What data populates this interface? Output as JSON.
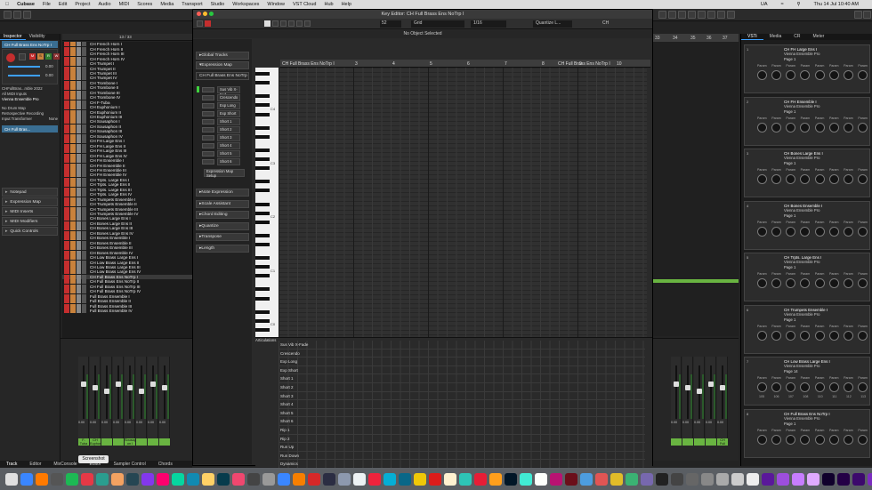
{
  "menubar": {
    "app": "Cubase",
    "items": [
      "File",
      "Edit",
      "Project",
      "Audio",
      "MIDI",
      "Scores",
      "Media",
      "Transport",
      "Studio",
      "Workspaces",
      "Window",
      "VST Cloud",
      "Hub",
      "Help"
    ],
    "clock": "Thu 14 Jul 10:40 AM",
    "lang": "UA"
  },
  "key_editor": {
    "title": "Key Editor: CH Full Brass Ens NoTrp I",
    "status": "No Object Selected",
    "grid_label": "Grid",
    "quantize_value": "1/16",
    "quantize_mode": "Quantize L...",
    "zoom_value": "52",
    "ch_label": "CH",
    "ruler_track": "CH Full Brass Ens NoTrp I",
    "ruler_track_right": "CH Full Brass Ens NoTrp I",
    "bars": [
      "3",
      "4",
      "5",
      "6",
      "7",
      "8",
      "9",
      "10"
    ],
    "octaves": [
      "C4",
      "C3",
      "C2",
      "C1",
      "C0"
    ],
    "articulations_label": "Articulations",
    "articulations": [
      "Sus Vib X-Fade",
      "Crescendo",
      "Exp Long",
      "Exp Short",
      "Short 1",
      "Short 2",
      "Short 3",
      "Short 4",
      "Short 5",
      "Short 6",
      "Rip 1",
      "Rip 2",
      "Run Up",
      "Run Down",
      "Dynamics"
    ],
    "left": {
      "global_tracks": "Global Tracks",
      "expression_map": "Expression Map",
      "map_name": "CH Full Brass Ens NoTrp",
      "slots": [
        "Sus Vib X-Fad",
        "Crescendo",
        "Exp Long",
        "Exp Short",
        "Short 1",
        "Short 2",
        "Short 3",
        "Short 4",
        "Short 5",
        "Short 6"
      ],
      "setup_button": "Expression Map Setup",
      "sections": [
        "Note Expression",
        "Scale Assistant",
        "Chord Editing",
        "Quantize",
        "Transpose",
        "Length"
      ]
    }
  },
  "inspector": {
    "tabs": [
      "Inspector",
      "Visibility"
    ],
    "track_name": "CH Full Brass Ens NoTrp I",
    "read": "R",
    "write": "W",
    "value1": "0.00",
    "value2": "0.00",
    "input_short": "CHFullBras...mble 2022",
    "midi_inputs": "All MIDI Inputs",
    "instrument": "Vienna Ensemble Pro",
    "drum_map": "No Drum Map",
    "retro": "Retrospective Recording",
    "transformer_label": "Input Transformer",
    "transformer_value": "None",
    "track_name2": "CH Full Bras...",
    "sections": [
      "Notepad",
      "Expression Map",
      "MIDI Inserts",
      "MIDI Modifiers",
      "Quick Controls"
    ],
    "count": "13 / 33"
  },
  "tracks": [
    "CH French Horn I",
    "CH French Horn II",
    "CH French Horn III",
    "CH French Horn IV",
    "CH Trumpet I",
    "CH Trumpet II",
    "CH Trumpet III",
    "CH Trumpet IV",
    "CH Trombone I",
    "CH Trombone II",
    "CH Trombone III",
    "CH Trombone IV",
    "CH F-Tuba",
    "CH Euphonium I",
    "CH Euphonium II",
    "CH Euphonium III",
    "CH Sousaphon I",
    "CH Sousaphon II",
    "CH Sousaphon III",
    "CH Sousaphon IV",
    "CH FH Large Ens I",
    "CH FH Large Ens II",
    "CH FH Large Ens III",
    "CH FH Large Ens IV",
    "CH FH Ensemble I",
    "CH FH Ensemble II",
    "CH FH Ensemble III",
    "CH FH Ensemble IV",
    "CH Trpts. Large Ens I",
    "CH Trpts. Large Ens II",
    "CH Trpts. Large Ens III",
    "CH Trpts. Large Ens IV",
    "CH Trumpets Ensemble I",
    "CH Trumpets Ensemble II",
    "CH Trumpets Ensemble III",
    "CH Trumpets Ensemble IV",
    "CH Bones Large Ens I",
    "CH Bones Large Ens II",
    "CH Bones Large Ens III",
    "CH Bones Large Ens IV",
    "CH Bones Ensemble I",
    "CH Bones Ensemble II",
    "CH Bones Ensemble III",
    "CH Bones Ensemble IV",
    "CH Low Brass Large Ens I",
    "CH Low Brass Large Ens II",
    "CH Low Brass Large Ens III",
    "CH Low Brass Large Ens IV",
    "CH Full Brass Ens NoTrp I",
    "CH Full Brass Ens NoTrp II",
    "CH Full Brass Ens NoTrp III",
    "CH Full Brass Ens NoTrp IV",
    "Full Brass Ensemble I",
    "Full Brass Ensemble II",
    "Full Brass Ensemble III",
    "Full Brass Ensemble IV"
  ],
  "selected_track_index": 48,
  "arrange_bars": [
    "33",
    "34",
    "35",
    "36",
    "37"
  ],
  "mixer": {
    "channels": [
      "F-Tuba",
      "CH Euphon...",
      "",
      "",
      "Sousaph on I",
      "",
      "",
      ""
    ],
    "channels_right": [
      "",
      "",
      "",
      "",
      "CH Full Brass En"
    ],
    "val": "0.00"
  },
  "vsti": {
    "tabs": [
      "VSTi",
      "Media",
      "CR",
      "Meter"
    ],
    "slots": [
      {
        "num": "1",
        "title": "CH FH Large Ens I",
        "sub": "Vienna Ensemble Pro",
        "page": "Page 1",
        "vals": [
          "",
          "",
          "",
          "",
          "",
          "",
          "",
          ""
        ]
      },
      {
        "num": "2",
        "title": "CH FH Ensemble I",
        "sub": "Vienna Ensemble Pro",
        "page": "Page 1",
        "vals": [
          "",
          "",
          "",
          "",
          "",
          "",
          "",
          ""
        ]
      },
      {
        "num": "3",
        "title": "CH Bones Large Ens I",
        "sub": "Vienna Ensemble Pro",
        "page": "Page 1",
        "vals": [
          "",
          "",
          "",
          "",
          "",
          "",
          "",
          ""
        ]
      },
      {
        "num": "4",
        "title": "CH Bones Ensemble I",
        "sub": "Vienna Ensemble Pro",
        "page": "Page 1",
        "vals": [
          "",
          "",
          "",
          "",
          "",
          "",
          "",
          ""
        ]
      },
      {
        "num": "5",
        "title": "CH Trpts. Large Ens I",
        "sub": "Vienna Ensemble Pro",
        "page": "Page 1",
        "vals": [
          "",
          "",
          "",
          "",
          "",
          "",
          "",
          ""
        ]
      },
      {
        "num": "6",
        "title": "CH Trumpets Ensemble I",
        "sub": "Vienna Ensemble Pro",
        "page": "Page 1",
        "vals": [
          "",
          "",
          "",
          "",
          "",
          "",
          "",
          ""
        ]
      },
      {
        "num": "7",
        "title": "CH Low Brass Large Ens I",
        "sub": "Vienna Ensemble Pro",
        "page": "Page 14",
        "vals": [
          "105",
          "106",
          "107",
          "108",
          "110",
          "111",
          "112",
          "113"
        ]
      },
      {
        "num": "8",
        "title": "CH Full Brass Ens NoTrp I",
        "sub": "Vienna Ensemble Pro",
        "page": "Page 1",
        "vals": [
          "",
          "",
          "",
          "",
          "",
          "",
          "",
          ""
        ]
      }
    ],
    "param_label": "Param"
  },
  "bottom_tabs": [
    "Track",
    "Editor",
    "MixConsole",
    "Editor",
    "Sampler Control",
    "Chords"
  ],
  "tooltip": "Screenshot",
  "colors": {
    "accent": "#3da0ff",
    "track_green": "#69b441",
    "mute": "#c42e2e",
    "solo": "#c9823c"
  }
}
